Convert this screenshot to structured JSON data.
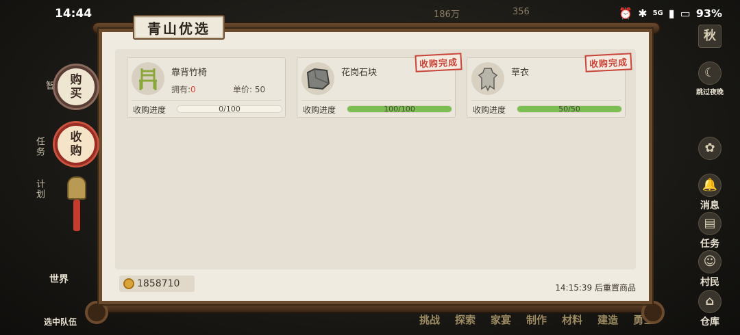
{
  "status_bar": {
    "time": "14:44",
    "battery": "93%",
    "network": "5G"
  },
  "top_resources": {
    "coins": "186万",
    "other": "356"
  },
  "left_side": {
    "label_1": "智",
    "tasks": "任务",
    "plan": "计划",
    "world": "世界",
    "team": "选中队伍"
  },
  "right_side": {
    "season": "秋",
    "skip_night": "跳过夜晚",
    "message": "消息",
    "task": "任务",
    "villager": "村民",
    "warehouse": "仓库"
  },
  "bottom_nav": [
    "挑战",
    "探索",
    "家宴",
    "制作",
    "材料",
    "建造",
    "勇士"
  ],
  "shop": {
    "title": "青山优选",
    "tabs": [
      {
        "label": "购买",
        "active": false
      },
      {
        "label": "收购",
        "active": true
      }
    ],
    "cards": [
      {
        "name": "靠背竹椅",
        "own_label": "拥有:",
        "own_value": "0",
        "price_label": "单价:",
        "price_value": "50",
        "progress_label": "收购进度",
        "progress_text": "0/100",
        "progress": 0.0,
        "completed_stamp": ""
      },
      {
        "name": "花岗石块",
        "own_label": "",
        "own_value": "",
        "price_label": "",
        "price_value": "",
        "progress_label": "收购进度",
        "progress_text": "100/100",
        "progress": 1.0,
        "completed_stamp": "收购完成"
      },
      {
        "name": "草衣",
        "own_label": "",
        "own_value": "",
        "price_label": "",
        "price_value": "",
        "progress_label": "收购进度",
        "progress_text": "50/50",
        "progress": 1.0,
        "completed_stamp": "收购完成"
      }
    ],
    "coins": "1858710",
    "reset_text": "14:15:39 后重置商品"
  },
  "icons": {
    "chair": "bamboo-chair-icon",
    "stone": "granite-stone-icon",
    "cloak": "straw-cloak-icon",
    "coin": "coin-icon"
  },
  "colors": {
    "progress_fill": "#7bbf52",
    "stamp_red": "#c8453a",
    "frame_wood": "#6a4b2e"
  }
}
